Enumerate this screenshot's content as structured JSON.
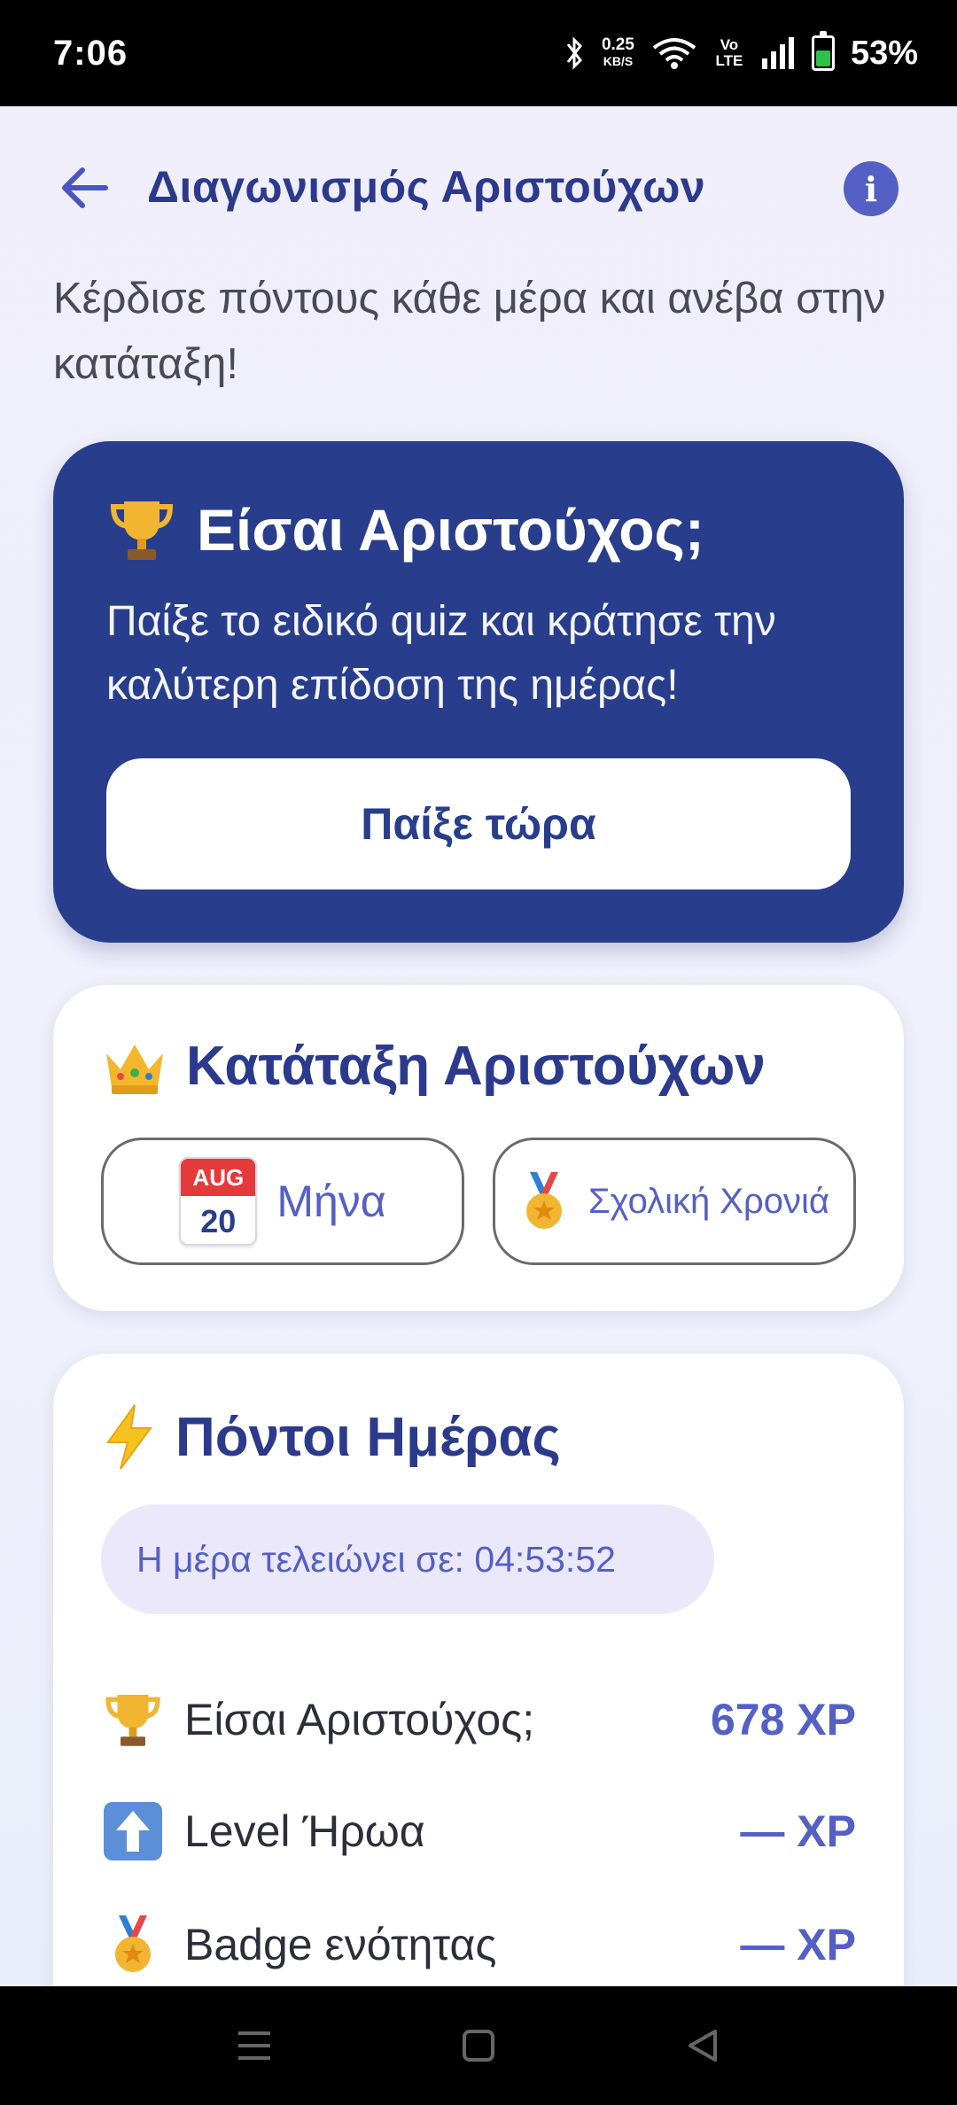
{
  "status_bar": {
    "time": "7:06",
    "net_speed": "0.25",
    "net_unit": "KB/S",
    "volte": "Vo LTE",
    "battery": "53%"
  },
  "header": {
    "title": "Διαγωνισμός Αριστούχων",
    "info_glyph": "i"
  },
  "subtitle": "Κέρδισε πόντους κάθε μέρα και ανέβα στην κατάταξη!",
  "hero": {
    "title": "Είσαι Αριστούχος;",
    "description": "Παίξε το ειδικό quiz και κράτησε την καλύτερη επίδοση της ημέρας!",
    "play_label": "Παίξε τώρα"
  },
  "ranking": {
    "title": "Κατάταξη Αριστούχων",
    "month_label": "Μήνα",
    "calendar_month": "AUG",
    "calendar_day": "20",
    "school_year_label": "Σχολική Χρονιά"
  },
  "points": {
    "title": "Πόντοι Ημέρας",
    "timer": "Η μέρα τελειώνει σε: 04:53:52",
    "rows": [
      {
        "label": "Είσαι Αριστούχος;",
        "value": "678 XP",
        "icon": "trophy-icon"
      },
      {
        "label": "Level Ήρωα",
        "value": "— XP",
        "icon": "up-arrow-icon"
      },
      {
        "label": "Badge ενότητας",
        "value": "— XP",
        "icon": "medal-icon"
      }
    ]
  },
  "colors": {
    "primary": "#283e8c",
    "accent": "#5460c4",
    "timer_bg": "#ebe8fb"
  }
}
